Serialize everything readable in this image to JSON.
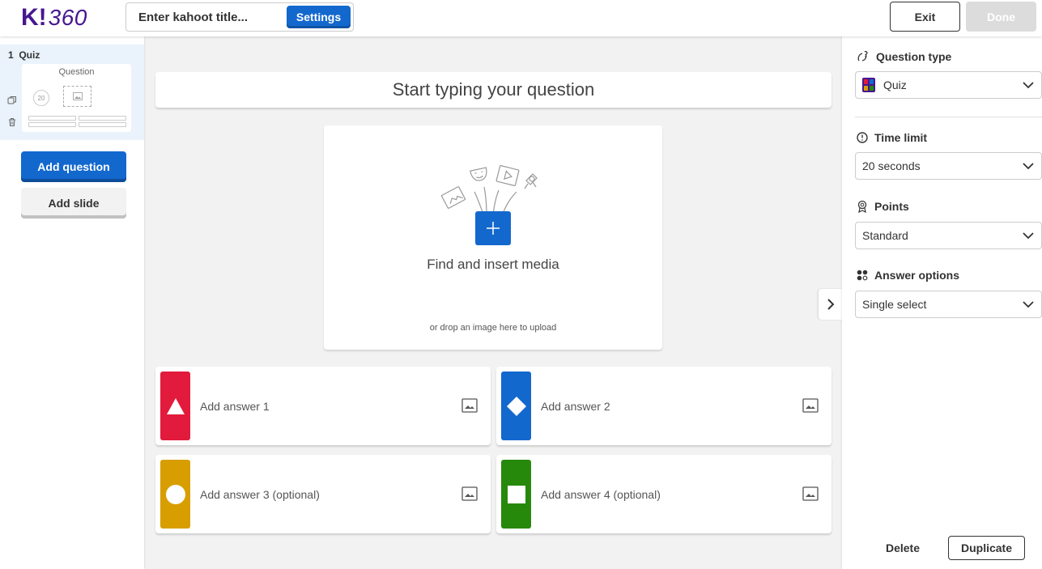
{
  "header": {
    "logo_k": "K!",
    "logo_num": "360",
    "title_placeholder": "Enter kahoot title...",
    "settings_label": "Settings",
    "exit_label": "Exit",
    "done_label": "Done"
  },
  "sidebar": {
    "slide_label": "1  Quiz",
    "thumb_title": "Question",
    "thumb_timer": "20",
    "add_question_label": "Add question",
    "add_slide_label": "Add slide"
  },
  "editor": {
    "question_placeholder": "Start typing your question",
    "media_text": "Find and insert media",
    "media_subtext": "or drop an image here to upload",
    "answers": [
      {
        "label": "Add answer 1",
        "shape": "triangle",
        "color": "#e21b3c"
      },
      {
        "label": "Add answer 2",
        "shape": "diamond",
        "color": "#1368ce"
      },
      {
        "label": "Add answer 3 (optional)",
        "shape": "circle",
        "color": "#d89e00"
      },
      {
        "label": "Add answer 4 (optional)",
        "shape": "square",
        "color": "#26890c"
      }
    ]
  },
  "right_panel": {
    "question_type_label": "Question type",
    "question_type_value": "Quiz",
    "time_limit_label": "Time limit",
    "time_limit_value": "20 seconds",
    "points_label": "Points",
    "points_value": "Standard",
    "answer_options_label": "Answer options",
    "answer_options_value": "Single select",
    "delete_label": "Delete",
    "duplicate_label": "Duplicate"
  },
  "colors": {
    "brand_purple": "#46178f",
    "primary_blue": "#1368ce",
    "answer_red": "#e21b3c",
    "answer_blue": "#1368ce",
    "answer_yellow": "#d89e00",
    "answer_green": "#26890c"
  }
}
